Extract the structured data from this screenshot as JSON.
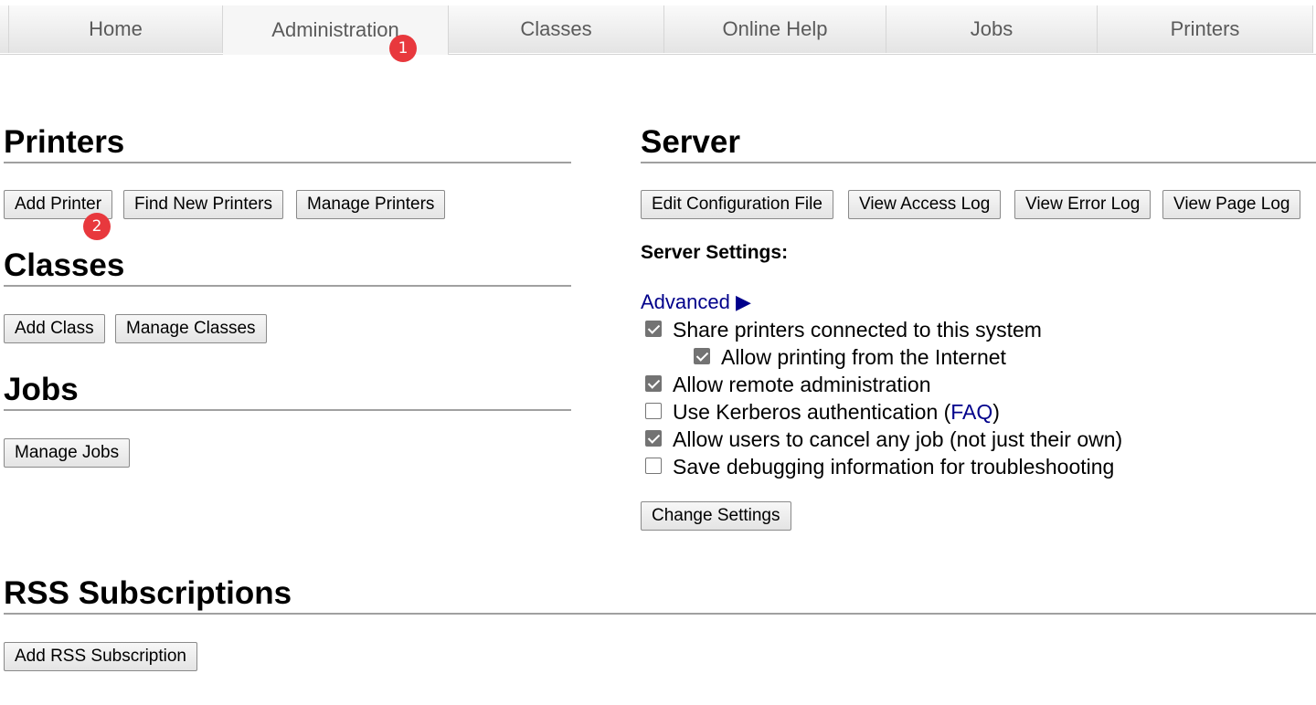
{
  "tabs": [
    {
      "label": "Home"
    },
    {
      "label": "Administration"
    },
    {
      "label": "Classes"
    },
    {
      "label": "Online Help"
    },
    {
      "label": "Jobs"
    },
    {
      "label": "Printers"
    }
  ],
  "active_tab": "Administration",
  "badges": {
    "first": "1",
    "second": "2"
  },
  "printers": {
    "heading": "Printers",
    "add": "Add Printer",
    "find": "Find New Printers",
    "manage": "Manage Printers"
  },
  "classes": {
    "heading": "Classes",
    "add": "Add Class",
    "manage": "Manage Classes"
  },
  "jobs": {
    "heading": "Jobs",
    "manage": "Manage Jobs"
  },
  "rss": {
    "heading": "RSS Subscriptions",
    "add": "Add RSS Subscription"
  },
  "server": {
    "heading": "Server",
    "edit_config": "Edit Configuration File",
    "view_access": "View Access Log",
    "view_error": "View Error Log",
    "view_page": "View Page Log",
    "settings_label": "Server Settings:",
    "advanced": "Advanced ▶",
    "options": {
      "share": {
        "label": "Share printers connected to this system",
        "checked": true
      },
      "internet": {
        "label": "Allow printing from the Internet",
        "checked": true
      },
      "remote_admin": {
        "label": "Allow remote administration",
        "checked": true
      },
      "kerberos": {
        "label": "Use Kerberos authentication (",
        "link": "FAQ",
        "suffix": ")",
        "checked": false
      },
      "cancel_any": {
        "label": "Allow users to cancel any job (not just their own)",
        "checked": true
      },
      "debug": {
        "label": "Save debugging information for troubleshooting",
        "checked": false
      }
    },
    "change_settings": "Change Settings"
  },
  "colors": {
    "link": "#00008b",
    "badge": "#e8383d"
  }
}
